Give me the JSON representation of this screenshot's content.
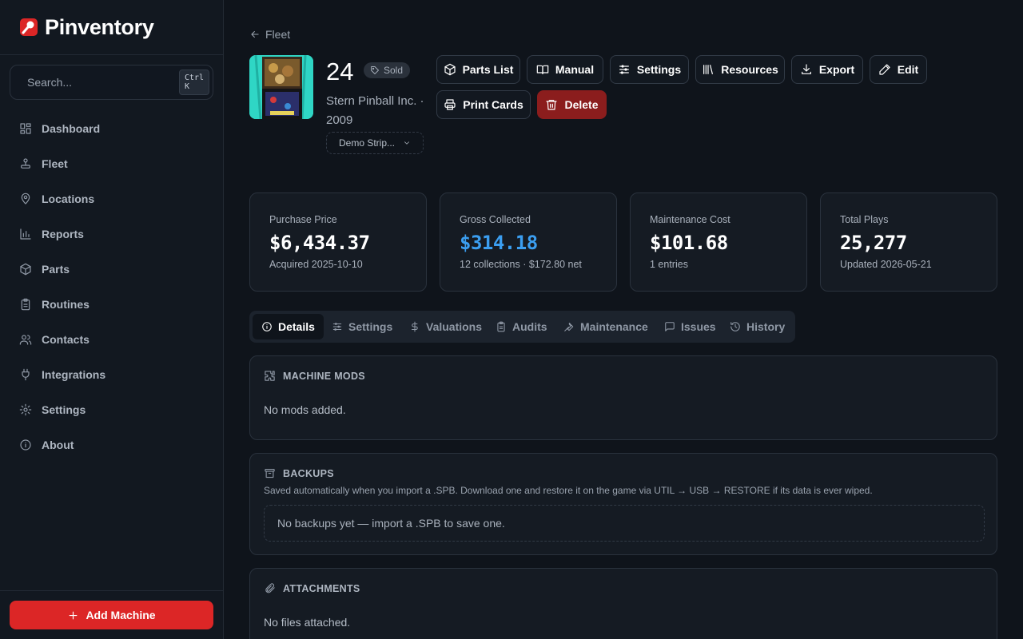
{
  "app": {
    "name": "Pinventory",
    "brand_color": "#dc2626"
  },
  "search": {
    "placeholder": "Search...",
    "shortcut": "Ctrl K"
  },
  "sidebar": {
    "items": [
      {
        "label": "Dashboard",
        "icon": "dashboard-icon"
      },
      {
        "label": "Fleet",
        "icon": "joystick-icon"
      },
      {
        "label": "Locations",
        "icon": "map-pin-icon"
      },
      {
        "label": "Reports",
        "icon": "bar-chart-icon"
      },
      {
        "label": "Parts",
        "icon": "box-icon"
      },
      {
        "label": "Routines",
        "icon": "clipboard-icon"
      },
      {
        "label": "Contacts",
        "icon": "users-icon"
      },
      {
        "label": "Integrations",
        "icon": "plug-icon"
      },
      {
        "label": "Settings",
        "icon": "gear-icon"
      },
      {
        "label": "About",
        "icon": "info-icon"
      }
    ],
    "add_button": "Add Machine"
  },
  "breadcrumb": {
    "back_label": "Fleet"
  },
  "machine": {
    "title": "24",
    "status": "Sold",
    "manufacturer_year": "Stern Pinball Inc. · 2009",
    "demo_select": "Demo Strip..."
  },
  "actions": [
    {
      "label": "Parts List",
      "icon": "box-icon"
    },
    {
      "label": "Manual",
      "icon": "book-icon"
    },
    {
      "label": "Settings",
      "icon": "sliders-icon"
    },
    {
      "label": "Resources",
      "icon": "library-icon"
    },
    {
      "label": "Export",
      "icon": "download-icon"
    },
    {
      "label": "Edit",
      "icon": "pencil-icon"
    },
    {
      "label": "Print Cards",
      "icon": "printer-icon"
    },
    {
      "label": "Delete",
      "icon": "trash-icon"
    }
  ],
  "stats": [
    {
      "label": "Purchase Price",
      "value": "$6,434.37",
      "sub": "Acquired 2025-10-10"
    },
    {
      "label": "Gross Collected",
      "value": "$314.18",
      "sub": "12 collections · $172.80 net",
      "color": "#3b9ef0"
    },
    {
      "label": "Maintenance Cost",
      "value": "$101.68",
      "sub": "1 entries"
    },
    {
      "label": "Total Plays",
      "value": "25,277",
      "sub": "Updated 2026-05-21"
    }
  ],
  "tabs": [
    {
      "label": "Details",
      "icon": "info-icon",
      "active": true
    },
    {
      "label": "Settings",
      "icon": "sliders-icon"
    },
    {
      "label": "Valuations",
      "icon": "dollar-icon"
    },
    {
      "label": "Audits",
      "icon": "clipboard-icon"
    },
    {
      "label": "Maintenance",
      "icon": "wrench-icon"
    },
    {
      "label": "Issues",
      "icon": "message-icon"
    },
    {
      "label": "History",
      "icon": "history-icon"
    }
  ],
  "panels": {
    "mods": {
      "title": "MACHINE MODS",
      "empty": "No mods added."
    },
    "backups": {
      "title": "BACKUPS",
      "description": "Saved automatically when you import a .SPB. Download one and restore it on the game via UTIL → USB → RESTORE if its data is ever wiped.",
      "empty": "No backups yet — import a .SPB to save one."
    },
    "attachments": {
      "title": "ATTACHMENTS",
      "empty": "No files attached."
    }
  }
}
